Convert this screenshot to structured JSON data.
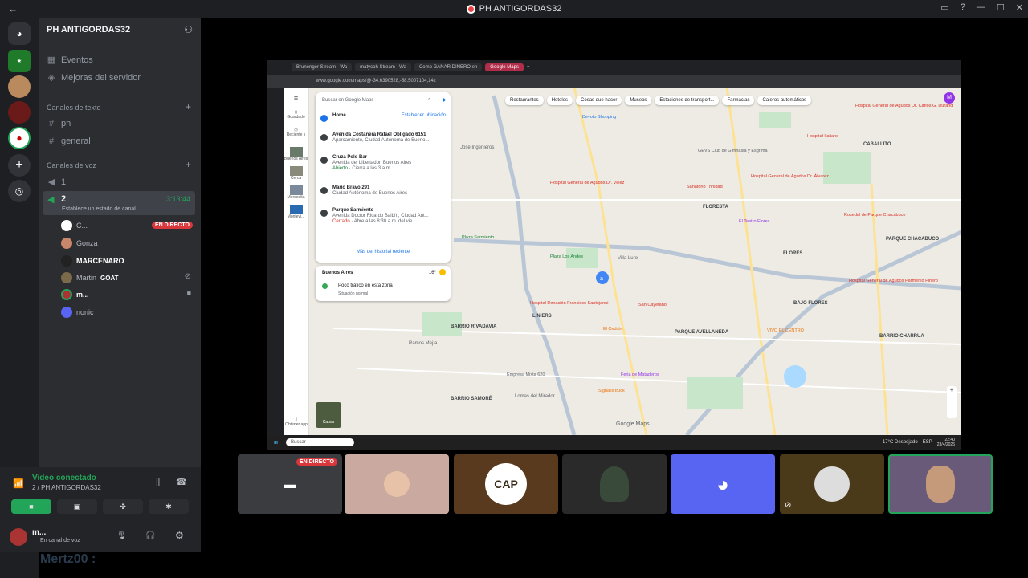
{
  "window": {
    "title": "PH ANTIGORDAS32"
  },
  "server": {
    "name": "PH ANTIGORDAS32"
  },
  "sidebar": {
    "events": "Eventos",
    "improvements": "Mejoras del servidor",
    "text_category": "Canales de texto",
    "text_channels": [
      "ph",
      "general"
    ],
    "voice_category": "Canales de voz",
    "voice_channels": [
      {
        "name": "1"
      },
      {
        "name": "2",
        "timer": "3:13:44",
        "status": "Establece un estado de canal"
      }
    ],
    "voice_users": [
      {
        "name": "C...",
        "badge": "EN DIRECTO"
      },
      {
        "name": "Gonza"
      },
      {
        "name": "MARCENARO"
      },
      {
        "name": "Martin",
        "tag": "GOAT"
      },
      {
        "name": "m..."
      },
      {
        "name": "nonic"
      }
    ]
  },
  "voice_panel": {
    "status": "Video conectado",
    "channel": "2 / PH ANTIGORDAS32"
  },
  "user_panel": {
    "name": "m...",
    "status": "En canal de voz"
  },
  "browser": {
    "tabs": [
      "Brunenger Stream - Wa",
      "matycoh Stream - Wa",
      "Como GANAR DINERO en",
      "Google Maps"
    ],
    "url": "www.google.com/maps/@-34.6390528,-58.5007104,14z"
  },
  "maps": {
    "search_placeholder": "Buscar en Google Maps",
    "home": "Home",
    "set_location": "Establecer ubicación",
    "history": [
      {
        "title": "Avenida Costanera Rafael Obligado 6151",
        "sub": "Aparcamiento, Ciudad Autónoma de Bueno..."
      },
      {
        "title": "Cruza Polo Bar",
        "sub": "Avenida del Libertador, Buenos Aires",
        "status": "Abierto",
        "status_detail": " · Cierra a las 3 a.m."
      },
      {
        "title": "Mario Bravo 291",
        "sub": "Ciudad Autónoma de Buenos Aires"
      },
      {
        "title": "Parque Sarmiento",
        "sub": "Avenida Doctor Ricardo Balbín, Ciudad Aut...",
        "closed": "Cerrado",
        "closed_detail": " · Abre a las 8:30 a.m. del vie"
      }
    ],
    "more_history": "Más del historial reciente",
    "weather_city": "Buenos Aires",
    "weather_temp": "16°",
    "traffic": "Poco tráfico en esta zona",
    "traffic_sub": "Situación normal",
    "chips": [
      "Restaurantes",
      "Hoteles",
      "Cosas que hacer",
      "Museos",
      "Estaciones de transport...",
      "Farmacias",
      "Cajeros automáticos"
    ],
    "rail": [
      "Guardado",
      "Reciente s",
      "Buenos Aires",
      "Cerca",
      "Mercedita",
      "Montevi...",
      "Obtener app"
    ],
    "layers": "Capas",
    "brand": "Google Maps",
    "labels": [
      "José Ingenieros",
      "CABALLITO",
      "FLORESTA",
      "FLORES",
      "LINIERS",
      "PARQUE CHACABUCO",
      "BAJO FLORES",
      "PARQUE AVELLANEDA",
      "BARRIO CHARRUA",
      "BARRIO RIVADAVIA",
      "Ramos Mejía",
      "Lomas del Mirador",
      "BARRIO SAMORÉ",
      "Villa Luro"
    ],
    "pois": [
      "Devoto Shopping",
      "Hospital General de Agudos Dr. Carlos G. Durand",
      "Hospital Italiano",
      "GEVS Club de Gimnasia y Esgrima",
      "Hospital General de Agudos Dr. Vélez",
      "Hospital General de Agudos Dr. Álvarez",
      "El Teatro Flores",
      "Sanatorio Trinidad",
      "Rosedal de Parque Chacabuco",
      "Plaza Sarmiento",
      "Plaza Los Andes",
      "Hospital Donación Francisco Santojanni",
      "San Cayetano",
      "El Cedrón",
      "Feria de Mataderos",
      "Signalis truck",
      "Empresa Mixta 620",
      "Hospital General de Agudos Parmenio Piñero",
      "VIVO EL CENTRO"
    ],
    "taskbar_search": "Buscar",
    "taskbar_weather": "17°C Despejado",
    "taskbar_time": "22:40",
    "taskbar_date": "23/4/2026",
    "taskbar_lang": "ESP"
  },
  "tiles": [
    {
      "name": "screen-share",
      "badge": "EN DIRECTO"
    },
    {
      "name": "gonza"
    },
    {
      "name": "marcenaro",
      "logo": "CAP"
    },
    {
      "name": "martin"
    },
    {
      "name": "discord-default"
    },
    {
      "name": "nonic"
    },
    {
      "name": "self-camera"
    }
  ],
  "watermark": "Mertz00 :",
  "colors": {
    "discord_bg": "#2b2d31",
    "live_red": "#da373c",
    "blurple": "#5865f2",
    "green": "#23a559"
  }
}
